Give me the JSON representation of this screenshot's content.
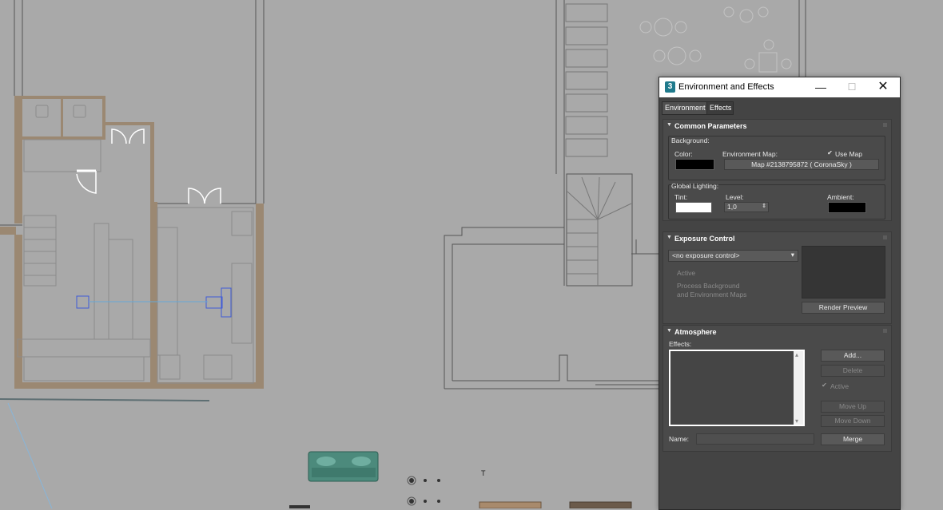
{
  "window": {
    "title": "Environment and Effects",
    "app_icon": "3",
    "minimize": "—",
    "maximize": "☐",
    "close": "✕"
  },
  "tabs": [
    {
      "label": "Environment"
    },
    {
      "label": "Effects"
    }
  ],
  "common": {
    "header": "Common Parameters",
    "background_label": "Background:",
    "color_label": "Color:",
    "env_map_label": "Environment Map:",
    "use_map_label": "Use Map",
    "use_map_checked": true,
    "env_map_button": "Map #2138795872  ( CoronaSky )",
    "global_lighting_label": "Global Lighting:",
    "tint_label": "Tint:",
    "level_label": "Level:",
    "level_value": "1,0",
    "ambient_label": "Ambient:",
    "colors": {
      "background": "#000000",
      "tint": "#ffffff",
      "ambient": "#000000"
    }
  },
  "exposure": {
    "header": "Exposure Control",
    "selected": "<no exposure control>",
    "active_label": "Active",
    "process_label_1": "Process Background",
    "process_label_2": "and Environment Maps",
    "render_preview": "Render Preview"
  },
  "atmosphere": {
    "header": "Atmosphere",
    "effects_label": "Effects:",
    "add": "Add...",
    "delete": "Delete",
    "active_label": "Active",
    "active_checked": true,
    "move_up": "Move Up",
    "move_down": "Move Down",
    "name_label": "Name:",
    "merge": "Merge"
  },
  "icons": {
    "collapse": "▼",
    "dropdown_arrow": "▾",
    "spinner_arrows": "⇕",
    "check": "✔",
    "scroll_up": "▴",
    "scroll_down": "▾"
  },
  "viewport": {
    "text_marker": "T"
  }
}
